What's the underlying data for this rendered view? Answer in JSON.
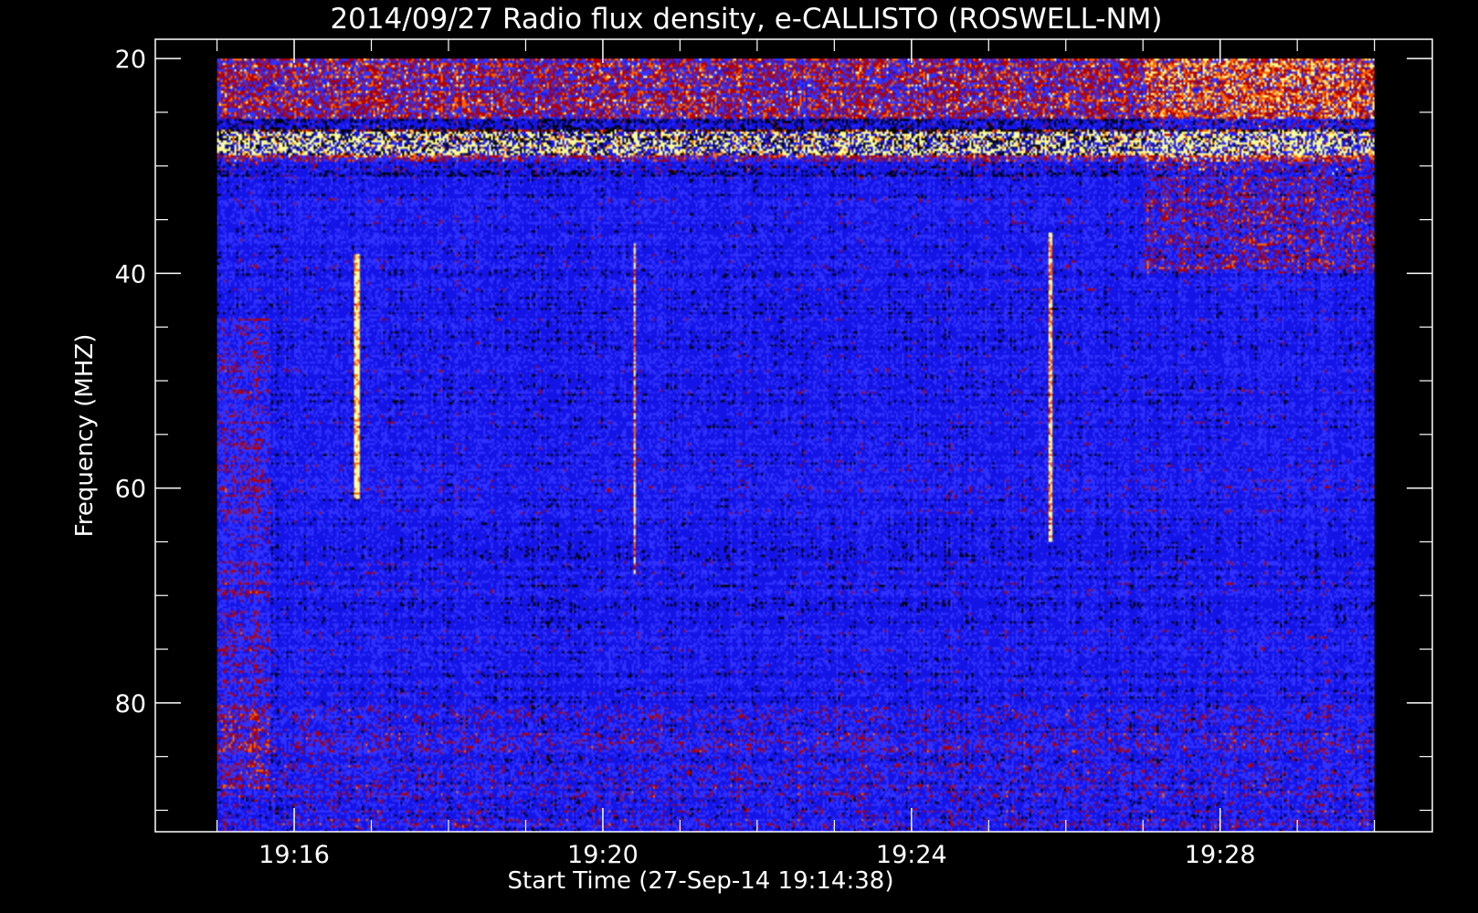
{
  "chart_data": {
    "type": "heatmap",
    "title": "2014/09/27  Radio flux density, e-CALLISTO (ROSWELL-NM)",
    "xlabel": "Start Time (27-Sep-14 19:14:38)",
    "ylabel": "Frequency (MHZ)",
    "y_axis": {
      "inverted": true,
      "range": [
        18.2,
        92.0
      ],
      "major_ticks": [
        20,
        40,
        60,
        80
      ],
      "minor_ticks": [
        25,
        30,
        35,
        45,
        50,
        55,
        65,
        70,
        75,
        85,
        90
      ]
    },
    "x_axis": {
      "range_minutes": [
        0,
        16.55
      ],
      "major_ticks": [
        {
          "label": "19:16",
          "minutes": 1.8
        },
        {
          "label": "19:20",
          "minutes": 5.8
        },
        {
          "label": "19:24",
          "minutes": 9.8
        },
        {
          "label": "19:28",
          "minutes": 13.8
        }
      ],
      "minor_ticks_minutes": [
        0.8,
        2.8,
        3.8,
        4.8,
        6.8,
        7.8,
        8.8,
        10.8,
        11.8,
        12.8,
        14.8,
        15.8
      ]
    },
    "data_extent": {
      "minutes": [
        0.8,
        15.8
      ],
      "freq_mhz": [
        20,
        92
      ]
    },
    "colormap": {
      "low": "#000000",
      "mid_low": "#1414e6",
      "mid": "#3232ff",
      "mid_high": "#b40000",
      "high": "#ff6400",
      "peak": "#ffff96"
    },
    "features": [
      {
        "name": "bright interference band",
        "freq_mhz": [
          26.5,
          29
        ]
      },
      {
        "name": "strong emission top band",
        "freq_mhz": [
          20,
          31
        ]
      },
      {
        "name": "vertical burst",
        "minutes": 2.6,
        "freq_mhz": [
          38,
          61
        ]
      },
      {
        "name": "vertical burst",
        "minutes": 6.2,
        "freq_mhz": [
          37,
          68
        ]
      },
      {
        "name": "vertical burst",
        "minutes": 11.6,
        "freq_mhz": [
          36,
          65
        ]
      },
      {
        "name": "active region",
        "minutes": [
          12.8,
          15.8
        ],
        "freq_mhz": [
          20,
          40
        ]
      }
    ]
  }
}
